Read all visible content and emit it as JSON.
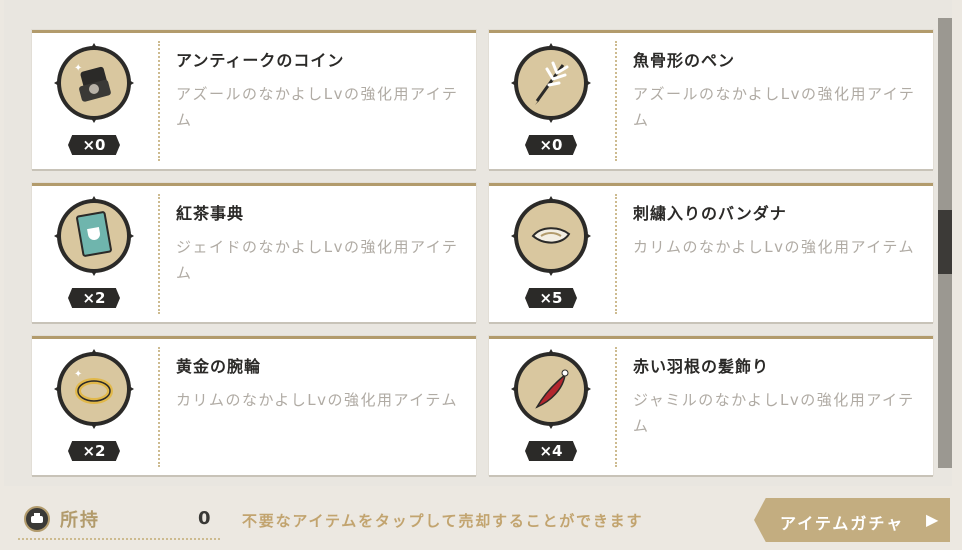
{
  "items": [
    {
      "name": "アンティークのコイン",
      "desc": "アズールのなかよしLvの強化用アイテム",
      "count": "×0",
      "icon": "coin-case-icon"
    },
    {
      "name": "魚骨形のペン",
      "desc": "アズールのなかよしLvの強化用アイテム",
      "count": "×0",
      "icon": "fishbone-pen-icon"
    },
    {
      "name": "紅茶事典",
      "desc": "ジェイドのなかよしLvの強化用アイテム",
      "count": "×2",
      "icon": "tea-book-icon"
    },
    {
      "name": "刺繍入りのバンダナ",
      "desc": "カリムのなかよしLvの強化用アイテム",
      "count": "×5",
      "icon": "bandana-icon"
    },
    {
      "name": "黄金の腕輪",
      "desc": "カリムのなかよしLvの強化用アイテム",
      "count": "×2",
      "icon": "gold-bracelet-icon"
    },
    {
      "name": "赤い羽根の髪飾り",
      "desc": "ジャミルのなかよしLvの強化用アイテム",
      "count": "×4",
      "icon": "red-feather-icon"
    }
  ],
  "footer": {
    "owned_label": "所持",
    "owned_value": "0",
    "hint": "不要なアイテムをタップして売却することができます",
    "gacha_label": "アイテムガチャ",
    "gacha_arrow": "▶"
  },
  "colors": {
    "accent": "#b29b6c",
    "button": "#c3ad80",
    "dark": "#2b2a28"
  }
}
